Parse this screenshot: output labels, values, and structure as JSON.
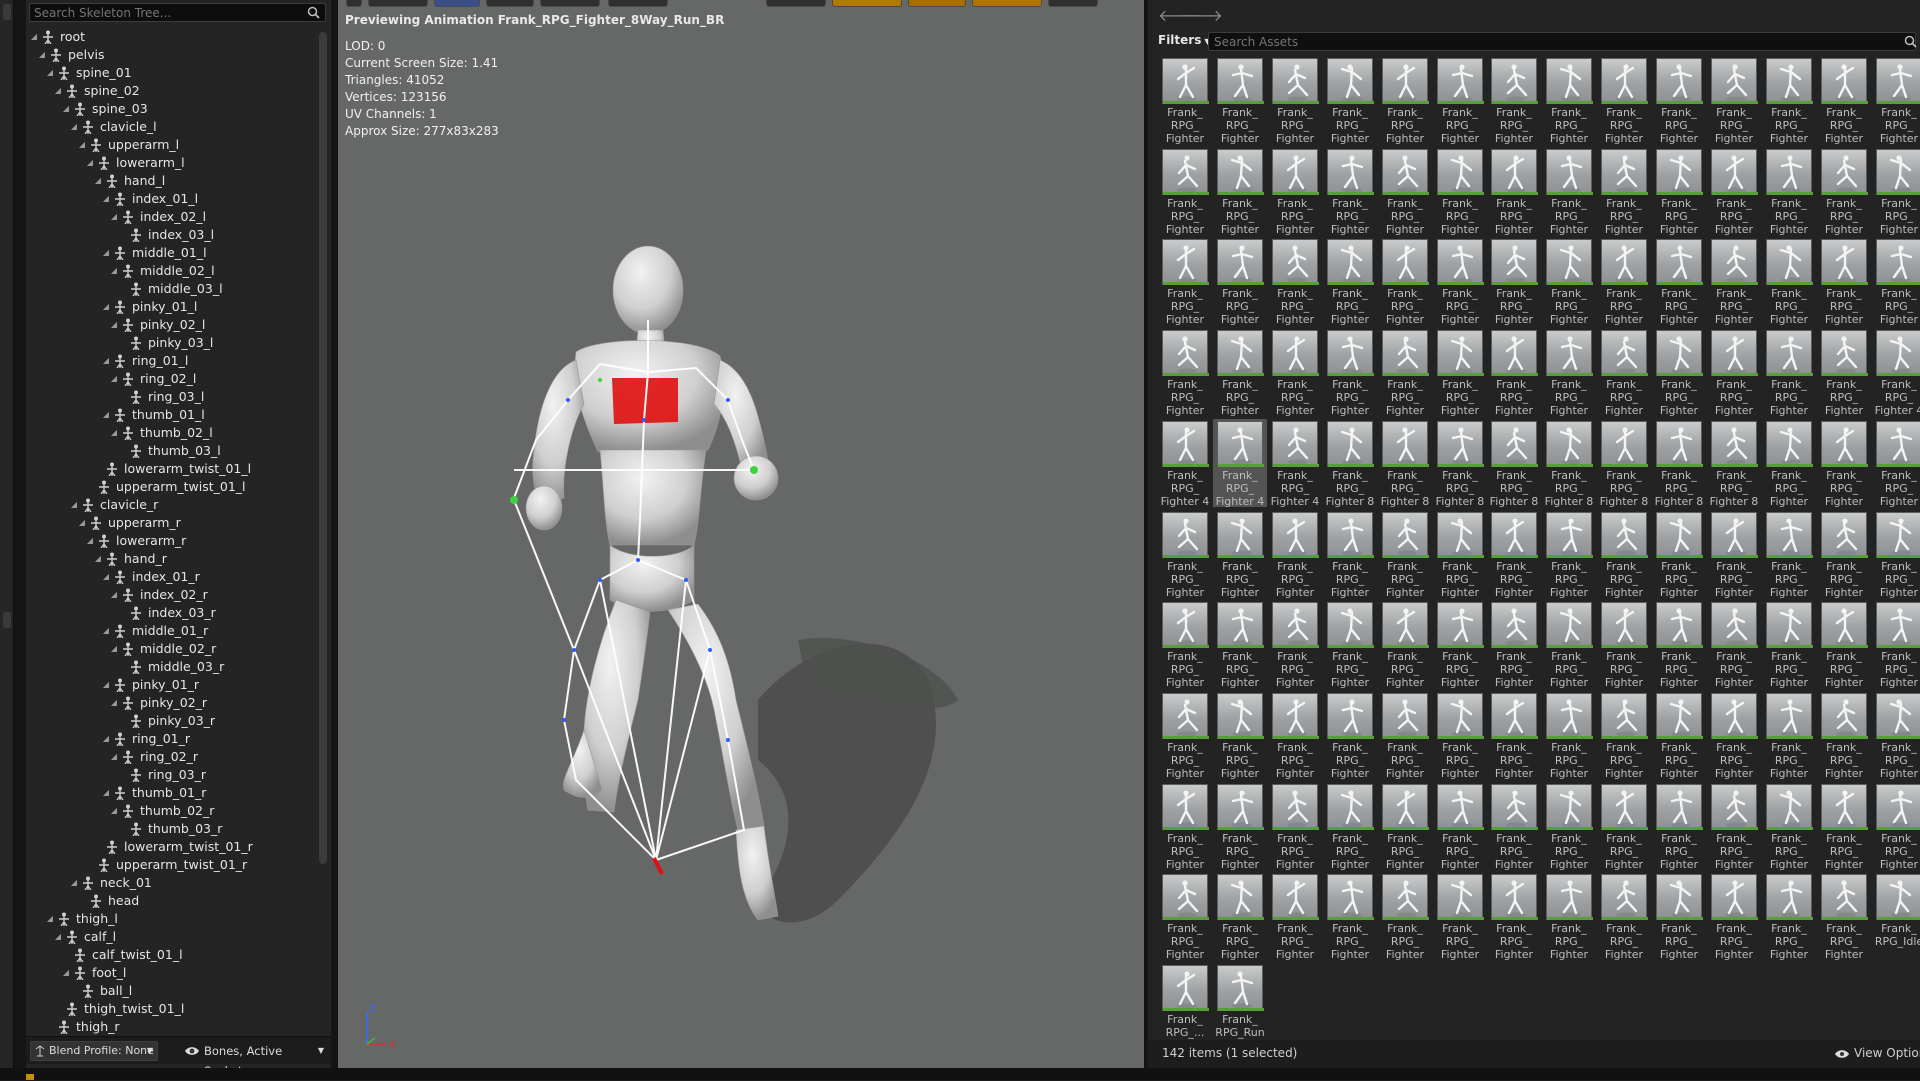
{
  "skeleton": {
    "search_placeholder": "Search Skeleton Tree...",
    "bones": [
      {
        "name": "root",
        "depth": 0
      },
      {
        "name": "pelvis",
        "depth": 1
      },
      {
        "name": "spine_01",
        "depth": 2
      },
      {
        "name": "spine_02",
        "depth": 3
      },
      {
        "name": "spine_03",
        "depth": 4
      },
      {
        "name": "clavicle_l",
        "depth": 5
      },
      {
        "name": "upperarm_l",
        "depth": 6
      },
      {
        "name": "lowerarm_l",
        "depth": 7
      },
      {
        "name": "hand_l",
        "depth": 8
      },
      {
        "name": "index_01_l",
        "depth": 9
      },
      {
        "name": "index_02_l",
        "depth": 10
      },
      {
        "name": "index_03_l",
        "depth": 11
      },
      {
        "name": "middle_01_l",
        "depth": 9
      },
      {
        "name": "middle_02_l",
        "depth": 10
      },
      {
        "name": "middle_03_l",
        "depth": 11
      },
      {
        "name": "pinky_01_l",
        "depth": 9
      },
      {
        "name": "pinky_02_l",
        "depth": 10
      },
      {
        "name": "pinky_03_l",
        "depth": 11
      },
      {
        "name": "ring_01_l",
        "depth": 9
      },
      {
        "name": "ring_02_l",
        "depth": 10
      },
      {
        "name": "ring_03_l",
        "depth": 11
      },
      {
        "name": "thumb_01_l",
        "depth": 9
      },
      {
        "name": "thumb_02_l",
        "depth": 10
      },
      {
        "name": "thumb_03_l",
        "depth": 11
      },
      {
        "name": "lowerarm_twist_01_l",
        "depth": 8
      },
      {
        "name": "upperarm_twist_01_l",
        "depth": 7
      },
      {
        "name": "clavicle_r",
        "depth": 5
      },
      {
        "name": "upperarm_r",
        "depth": 6
      },
      {
        "name": "lowerarm_r",
        "depth": 7
      },
      {
        "name": "hand_r",
        "depth": 8
      },
      {
        "name": "index_01_r",
        "depth": 9
      },
      {
        "name": "index_02_r",
        "depth": 10
      },
      {
        "name": "index_03_r",
        "depth": 11
      },
      {
        "name": "middle_01_r",
        "depth": 9
      },
      {
        "name": "middle_02_r",
        "depth": 10
      },
      {
        "name": "middle_03_r",
        "depth": 11
      },
      {
        "name": "pinky_01_r",
        "depth": 9
      },
      {
        "name": "pinky_02_r",
        "depth": 10
      },
      {
        "name": "pinky_03_r",
        "depth": 11
      },
      {
        "name": "ring_01_r",
        "depth": 9
      },
      {
        "name": "ring_02_r",
        "depth": 10
      },
      {
        "name": "ring_03_r",
        "depth": 11
      },
      {
        "name": "thumb_01_r",
        "depth": 9
      },
      {
        "name": "thumb_02_r",
        "depth": 10
      },
      {
        "name": "thumb_03_r",
        "depth": 11
      },
      {
        "name": "lowerarm_twist_01_r",
        "depth": 8
      },
      {
        "name": "upperarm_twist_01_r",
        "depth": 7
      },
      {
        "name": "neck_01",
        "depth": 5
      },
      {
        "name": "head",
        "depth": 6
      },
      {
        "name": "thigh_l",
        "depth": 2
      },
      {
        "name": "calf_l",
        "depth": 3
      },
      {
        "name": "calf_twist_01_l",
        "depth": 4
      },
      {
        "name": "foot_l",
        "depth": 4
      },
      {
        "name": "ball_l",
        "depth": 5
      },
      {
        "name": "thigh_twist_01_l",
        "depth": 3
      },
      {
        "name": "thigh_r",
        "depth": 2
      }
    ],
    "blend_profile_label": "Blend Profile: None",
    "visibility_label": "Bones, Active Sockets"
  },
  "viewport": {
    "title": "Previewing Animation Frank_RPG_Fighter_8Way_Run_BR",
    "stats": [
      "LOD: 0",
      "Current Screen Size: 1.41",
      "Triangles: 41052",
      "Vertices: 123156",
      "UV Channels: 1",
      "Approx Size: 277x83x283"
    ],
    "axis_labels": {
      "z": "Z",
      "x": "X"
    }
  },
  "asset_browser": {
    "filters_label": "Filters",
    "search_placeholder": "Search Assets",
    "status": "142 items (1 selected)",
    "view_options_label": "View Options",
    "selected_index": 57,
    "assets": [
      "Frank_\nRPG_\nFighter",
      "Frank_\nRPG_\nFighter",
      "Frank_\nRPG_\nFighter",
      "Frank_\nRPG_\nFighter",
      "Frank_\nRPG_\nFighter",
      "Frank_\nRPG_\nFighter",
      "Frank_\nRPG_\nFighter",
      "Frank_\nRPG_\nFighter",
      "Frank_\nRPG_\nFighter",
      "Frank_\nRPG_\nFighter",
      "Frank_\nRPG_\nFighter",
      "Frank_\nRPG_\nFighter",
      "Frank_\nRPG_\nFighter",
      "Frank_\nRPG_\nFighter",
      "Frank_\nRPG_\nFighter",
      "Frank_\nRPG_\nFighter",
      "Frank_\nRPG_\nFighter",
      "Frank_\nRPG_\nFighter",
      "Frank_\nRPG_\nFighter",
      "Frank_\nRPG_\nFighter",
      "Frank_\nRPG_\nFighter",
      "Frank_\nRPG_\nFighter",
      "Frank_\nRPG_\nFighter",
      "Frank_\nRPG_\nFighter",
      "Frank_\nRPG_\nFighter",
      "Frank_\nRPG_\nFighter",
      "Frank_\nRPG_\nFighter",
      "Frank_\nRPG_\nFighter",
      "Frank_\nRPG_\nFighter",
      "Frank_\nRPG_\nFighter",
      "Frank_\nRPG_\nFighter",
      "Frank_\nRPG_\nFighter",
      "Frank_\nRPG_\nFighter",
      "Frank_\nRPG_\nFighter",
      "Frank_\nRPG_\nFighter",
      "Frank_\nRPG_\nFighter",
      "Frank_\nRPG_\nFighter",
      "Frank_\nRPG_\nFighter",
      "Frank_\nRPG_\nFighter",
      "Frank_\nRPG_\nFighter",
      "Frank_\nRPG_\nFighter",
      "Frank_\nRPG_\nFighter",
      "Frank_\nRPG_\nFighter",
      "Frank_\nRPG_\nFighter",
      "Frank_\nRPG_\nFighter",
      "Frank_\nRPG_\nFighter",
      "Frank_\nRPG_\nFighter",
      "Frank_\nRPG_\nFighter",
      "Frank_\nRPG_\nFighter",
      "Frank_\nRPG_\nFighter",
      "Frank_\nRPG_\nFighter",
      "Frank_\nRPG_\nFighter",
      "Frank_\nRPG_\nFighter",
      "Frank_\nRPG_\nFighter",
      "Frank_\nRPG_\nFighter",
      "Frank_\nRPG_\nFighter 4",
      "Frank_\nRPG_\nFighter 4",
      "Frank_\nRPG_\nFighter 4",
      "Frank_\nRPG_\nFighter 4",
      "Frank_\nRPG_\nFighter 8",
      "Frank_\nRPG_\nFighter 8",
      "Frank_\nRPG_\nFighter 8",
      "Frank_\nRPG_\nFighter 8",
      "Frank_\nRPG_\nFighter 8",
      "Frank_\nRPG_\nFighter 8",
      "Frank_\nRPG_\nFighter 8",
      "Frank_\nRPG_\nFighter 8",
      "Frank_\nRPG_\nFighter",
      "Frank_\nRPG_\nFighter",
      "Frank_\nRPG_\nFighter",
      "Frank_\nRPG_\nFighter",
      "Frank_\nRPG_\nFighter",
      "Frank_\nRPG_\nFighter",
      "Frank_\nRPG_\nFighter",
      "Frank_\nRPG_\nFighter",
      "Frank_\nRPG_\nFighter",
      "Frank_\nRPG_\nFighter",
      "Frank_\nRPG_\nFighter",
      "Frank_\nRPG_\nFighter",
      "Frank_\nRPG_\nFighter",
      "Frank_\nRPG_\nFighter",
      "Frank_\nRPG_\nFighter",
      "Frank_\nRPG_\nFighter",
      "Frank_\nRPG_\nFighter",
      "Frank_\nRPG_\nFighter",
      "Frank_\nRPG_\nFighter",
      "Frank_\nRPG_\nFighter",
      "Frank_\nRPG_\nFighter",
      "Frank_\nRPG_\nFighter",
      "Frank_\nRPG_\nFighter",
      "Frank_\nRPG_\nFighter",
      "Frank_\nRPG_\nFighter",
      "Frank_\nRPG_\nFighter",
      "Frank_\nRPG_\nFighter",
      "Frank_\nRPG_\nFighter",
      "Frank_\nRPG_\nFighter",
      "Frank_\nRPG_\nFighter",
      "Frank_\nRPG_\nFighter",
      "Frank_\nRPG_\nFighter",
      "Frank_\nRPG_\nFighter",
      "Frank_\nRPG_\nFighter",
      "Frank_\nRPG_\nFighter",
      "Frank_\nRPG_\nFighter",
      "Frank_\nRPG_\nFighter",
      "Frank_\nRPG_\nFighter",
      "Frank_\nRPG_\nFighter",
      "Frank_\nRPG_\nFighter",
      "Frank_\nRPG_\nFighter",
      "Frank_\nRPG_\nFighter",
      "Frank_\nRPG_\nFighter",
      "Frank_\nRPG_\nFighter",
      "Frank_\nRPG_\nFighter",
      "Frank_\nRPG_\nFighter",
      "Frank_\nRPG_\nFighter",
      "Frank_\nRPG_\nFighter",
      "Frank_\nRPG_\nFighter",
      "Frank_\nRPG_\nFighter",
      "Frank_\nRPG_\nFighter",
      "Frank_\nRPG_\nFighter",
      "Frank_\nRPG_\nFighter",
      "Frank_\nRPG_\nFighter",
      "Frank_\nRPG_\nFighter",
      "Frank_\nRPG_\nFighter",
      "Frank_\nRPG_\nFighter",
      "Frank_\nRPG_\nFighter",
      "Frank_\nRPG_\nFighter",
      "Frank_\nRPG_\nFighter",
      "Frank_\nRPG_\nFighter",
      "Frank_\nRPG_\nFighter",
      "Frank_\nRPG_\nFighter",
      "Frank_\nRPG_\nFighter",
      "Frank_\nRPG_\nFighter",
      "Frank_\nRPG_\nFighter",
      "Frank_\nRPG_\nFighter",
      "Frank_\nRPG_\nFighter",
      "Frank_\nRPG_\nFighter",
      "Frank_\nRPG_\nFighter",
      "Frank_\nRPG_\nFighter",
      "Frank_\nRPG_\nFighter",
      "Frank_\nRPG_Idle",
      "Frank_\nRPG_...",
      "Frank_\nRPG_Run"
    ]
  },
  "colors": {
    "accent_green": "#57a038",
    "selection": "#545454",
    "status_yellow": "#c98e00"
  }
}
